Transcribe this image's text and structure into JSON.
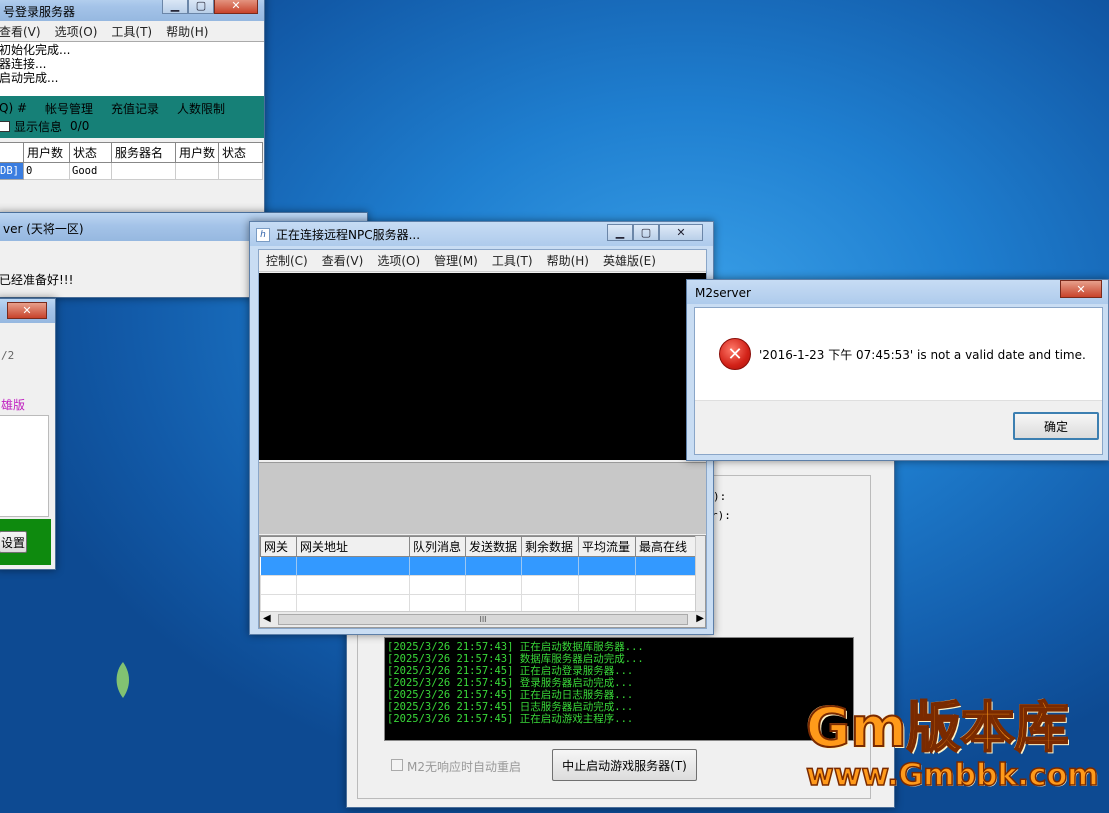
{
  "login_server": {
    "title": "号登录服务器",
    "menu": [
      "查看(V)",
      "选项(O)",
      "工具(T)",
      "帮助(H)"
    ],
    "log": [
      "初始化完成...",
      "器连接...",
      "启动完成..."
    ],
    "teal_tabs": [
      "Q) #",
      "帐号管理",
      "充值记录",
      "人数限制"
    ],
    "show_info_label": "显示信息",
    "show_info_count": "0/0",
    "table_headers": [
      "",
      "用户数",
      "状态",
      "服务器名",
      "用户数",
      "状态"
    ],
    "table_row": [
      "DB]",
      "0",
      "Good",
      "",
      "",
      ""
    ]
  },
  "game_server_back": {
    "title": "ver (天将一区)",
    "message": "已经准备好!!!"
  },
  "left_small": {
    "text1": "/2",
    "text2": "雄版",
    "button": "设置"
  },
  "npc_window": {
    "title": "正在连接远程NPC服务器...",
    "menu": [
      "控制(C)",
      "查看(V)",
      "选项(O)",
      "管理(M)",
      "工具(T)",
      "帮助(H)",
      "英雄版(E)"
    ],
    "grid_headers": [
      "网关",
      "网关地址",
      "队列消息",
      "发送数据",
      "剩余数据",
      "平均流量",
      "最高在线"
    ],
    "scroll_mid": "III"
  },
  "game_control": {
    "side_text": [
      "):",
      "r):"
    ],
    "log": [
      "[2025/3/26 21:57:43] 正在启动数据库服务器...",
      "[2025/3/26 21:57:43] 数据库服务器启动完成...",
      "[2025/3/26 21:57:45] 正在启动登录服务器...",
      "[2025/3/26 21:57:45] 登录服务器启动完成...",
      "[2025/3/26 21:57:45] 正在启动日志服务器...",
      "[2025/3/26 21:57:45] 日志服务器启动完成...",
      "[2025/3/26 21:57:45] 正在启动游戏主程序..."
    ],
    "auto_restart_label": "M2无响应时自动重启",
    "stop_button": "中止启动游戏服务器(T)"
  },
  "dialog": {
    "title": "M2server",
    "message": "'2016-1-23 下午 07:45:53' is not a valid date and time.",
    "ok_button": "确定"
  },
  "watermark": {
    "line1": "Gm版本库",
    "line2": "www.Gmbbk.com"
  },
  "colors": {
    "log_green": "#39d839",
    "teal": "#168077",
    "watermark_orange": "#ff9a1a"
  }
}
